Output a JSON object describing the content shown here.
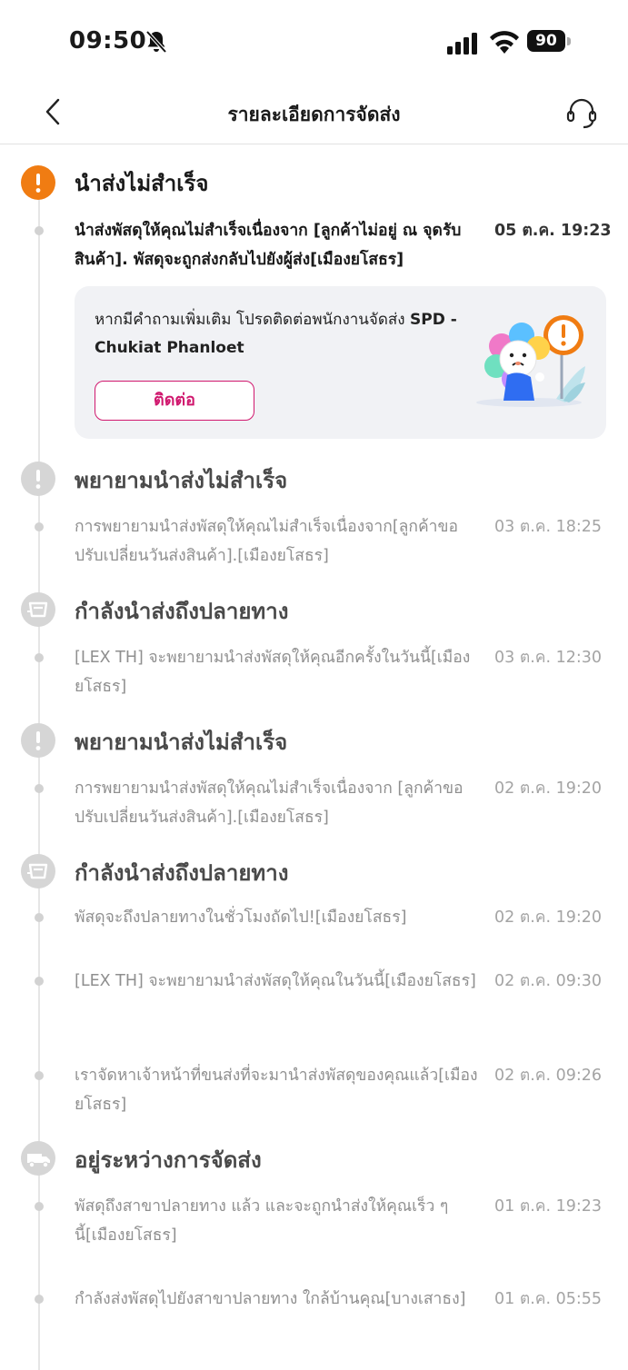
{
  "status_bar": {
    "time": "09:50",
    "battery": "90"
  },
  "nav": {
    "title": "รายละเอียดการจัดส่ง"
  },
  "colors": {
    "alert": "#f07c12",
    "accent": "#d0186e",
    "done": "#d6d6d6"
  },
  "timeline": [
    {
      "icon": "alert-icon",
      "title": "นำส่งไม่สำเร็จ",
      "events": [
        {
          "text": "นำส่งพัสดุให้คุณไม่สำเร็จเนื่องจาก [ลูกค้าไม่อยู่ ณ จุดรับสินค้า]. พัสดุจะถูกส่งกลับไปยังผู้ส่ง[เมืองยโสธร]",
          "time": "05 ต.ค. 19:23"
        }
      ],
      "card": {
        "text": "หากมีคำถามเพิ่มเติม โปรดติดต่อพนักงานจัดส่ง",
        "courier": "SPD - Chukiat Phanloet",
        "button": "ติดต่อ"
      }
    },
    {
      "icon": "alert-icon",
      "title": "พยายามนำส่งไม่สำเร็จ",
      "events": [
        {
          "text": "การพยายามนำส่งพัสดุให้คุณไม่สำเร็จเนื่องจาก[ลูกค้าขอปรับเปลี่ยนวันส่งสินค้า].[เมืองยโสธร]",
          "time": "03 ต.ค. 18:25"
        }
      ]
    },
    {
      "icon": "delivery-box-icon",
      "title": "กำลังนำส่งถึงปลายทาง",
      "events": [
        {
          "text": "[LEX TH] จะพยายามนำส่งพัสดุให้คุณอีกครั้งในวันนี้[เมืองยโสธร]",
          "time": "03 ต.ค. 12:30"
        }
      ]
    },
    {
      "icon": "alert-icon",
      "title": "พยายามนำส่งไม่สำเร็จ",
      "events": [
        {
          "text": "การพยายามนำส่งพัสดุให้คุณไม่สำเร็จเนื่องจาก [ลูกค้าขอปรับเปลี่ยนวันส่งสินค้า].[เมืองยโสธร]",
          "time": "02 ต.ค. 19:20"
        }
      ]
    },
    {
      "icon": "delivery-box-icon",
      "title": "กำลังนำส่งถึงปลายทาง",
      "events": [
        {
          "text": "พัสดุจะถึงปลายทางในชั่วโมงถัดไป![เมืองยโสธร]",
          "time": "02 ต.ค. 19:20"
        },
        {
          "text": "[LEX TH] จะพยายามนำส่งพัสดุให้คุณในวันนี้[เมืองยโสธร]",
          "time": "02 ต.ค. 09:30"
        },
        {
          "text": "เราจัดหาเจ้าหน้าที่ขนส่งที่จะมานำส่งพัสดุของคุณแล้ว[เมืองยโสธร]",
          "time": "02 ต.ค. 09:26"
        }
      ]
    },
    {
      "icon": "truck-icon",
      "title": "อยู่ระหว่างการจัดส่ง",
      "events": [
        {
          "text": "พัสดุถึงสาขาปลายทาง แล้ว และจะถูกนำส่งให้คุณเร็ว ๆ นี้[เมืองยโสธร]",
          "time": "01 ต.ค. 19:23"
        },
        {
          "text": "กำลังส่งพัสดุไปยังสาขาปลายทาง ใกล้บ้านคุณ[บางเสาธง]",
          "time": "01 ต.ค. 05:55"
        }
      ]
    }
  ]
}
